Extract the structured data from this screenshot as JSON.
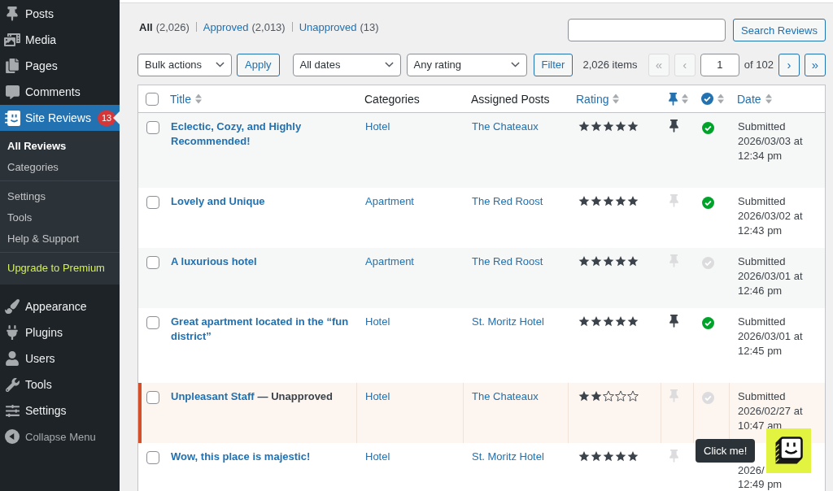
{
  "sidebar": {
    "groups": [
      {
        "items": [
          {
            "label": "Posts",
            "selected": false
          },
          {
            "label": "Media",
            "selected": false
          },
          {
            "label": "Pages",
            "selected": false
          },
          {
            "label": "Comments",
            "selected": false
          },
          {
            "label": "Site Reviews",
            "selected": true,
            "badge": "13",
            "submenu": [
              {
                "items": [
                  {
                    "label": "All Reviews",
                    "selected": true,
                    "kind": "link"
                  },
                  {
                    "label": "Categories",
                    "selected": false,
                    "kind": "link"
                  }
                ]
              },
              {
                "items": [
                  {
                    "label": "Settings",
                    "selected": false,
                    "kind": "link"
                  },
                  {
                    "label": "Tools",
                    "selected": false,
                    "kind": "link"
                  },
                  {
                    "label": "Help & Support",
                    "selected": false,
                    "kind": "link"
                  }
                ]
              },
              {
                "items": [
                  {
                    "label": "Upgrade to Premium",
                    "selected": false,
                    "kind": "upgrade"
                  }
                ]
              }
            ]
          }
        ]
      },
      {
        "items": [
          {
            "label": "Appearance",
            "selected": false
          },
          {
            "label": "Plugins",
            "selected": false
          },
          {
            "label": "Users",
            "selected": false
          },
          {
            "label": "Tools",
            "selected": false
          },
          {
            "label": "Settings",
            "selected": false
          }
        ]
      }
    ],
    "collapse": "Collapse Menu"
  },
  "views": [
    {
      "label": "All",
      "count": "(2,026)",
      "selected": true
    },
    {
      "label": "Approved",
      "count": "(2,013)",
      "selected": false
    },
    {
      "label": "Unapproved",
      "count": "(13)",
      "selected": false
    }
  ],
  "search": {
    "button": "Search Reviews"
  },
  "filters": {
    "bulk_actions": "Bulk actions",
    "apply": "Apply",
    "dates": "All dates",
    "rating": "Any rating",
    "filter": "Filter"
  },
  "pagination": {
    "count": "2,026 items",
    "first": {
      "label": "«",
      "disabled": true
    },
    "previous": {
      "label": "‹",
      "disabled": true
    },
    "page": "1",
    "total": "of 102",
    "next": {
      "label": "›",
      "disabled": false
    },
    "last": {
      "label": "»",
      "disabled": false
    }
  },
  "table": {
    "select_all_checked": false,
    "columns": [
      {
        "kind": "text",
        "label": "Title",
        "sortable": true
      },
      {
        "kind": "text",
        "label": "Categories",
        "sortable": false
      },
      {
        "kind": "text",
        "label": "Assigned Posts",
        "sortable": false
      },
      {
        "kind": "text",
        "label": "Rating",
        "sortable": true
      },
      {
        "kind": "icon",
        "sortable": true
      },
      {
        "kind": "icon",
        "sortable": true
      },
      {
        "kind": "text",
        "label": "Date",
        "sortable": true
      }
    ],
    "rows": [
      {
        "checked": false,
        "title": "Eclectic, Cozy, and Highly Recommended!",
        "unapproved": false,
        "category": "Hotel",
        "post": "The Chateaux",
        "stars": 5,
        "pinned": true,
        "verified": true,
        "date": {
          "kind": "full",
          "text": "Submitted 2026/03/03 at 12:34 pm"
        }
      },
      {
        "checked": false,
        "title": "Lovely and Unique",
        "unapproved": false,
        "category": "Apartment",
        "post": "The Red Roost",
        "stars": 5,
        "pinned": false,
        "verified": true,
        "date": {
          "kind": "full",
          "text": "Submitted 2026/03/02 at 12:43 pm"
        }
      },
      {
        "checked": false,
        "title": "A luxurious hotel",
        "unapproved": false,
        "category": "Apartment",
        "post": "The Red Roost",
        "stars": 5,
        "pinned": false,
        "verified": false,
        "date": {
          "kind": "full",
          "text": "Submitted 2026/03/01 at 12:46 pm"
        }
      },
      {
        "checked": false,
        "title": "Great apartment located in the “fun district”",
        "unapproved": false,
        "category": "Hotel",
        "post": "St. Moritz Hotel",
        "stars": 5,
        "pinned": true,
        "verified": true,
        "date": {
          "kind": "full",
          "text": "Submitted 2026/03/01 at 12:45 pm"
        }
      },
      {
        "checked": false,
        "title": "Unpleasant Staff",
        "status": "— Unapproved",
        "unapproved": true,
        "category": "Hotel",
        "post": "The Chateaux",
        "stars": 2,
        "pinned": false,
        "verified": false,
        "date": {
          "kind": "full",
          "text": "Submitted 2026/02/27 at 10:47 am"
        }
      },
      {
        "checked": false,
        "title": "Wow, this place is majestic!",
        "unapproved": false,
        "category": "Hotel",
        "post": "St. Moritz Hotel",
        "stars": 5,
        "pinned": false,
        "date": {
          "kind": "covered",
          "lines": [
            "2026/",
            "12:49 pm"
          ]
        }
      }
    ]
  },
  "help_widget": {
    "tooltip": "Click me!"
  }
}
